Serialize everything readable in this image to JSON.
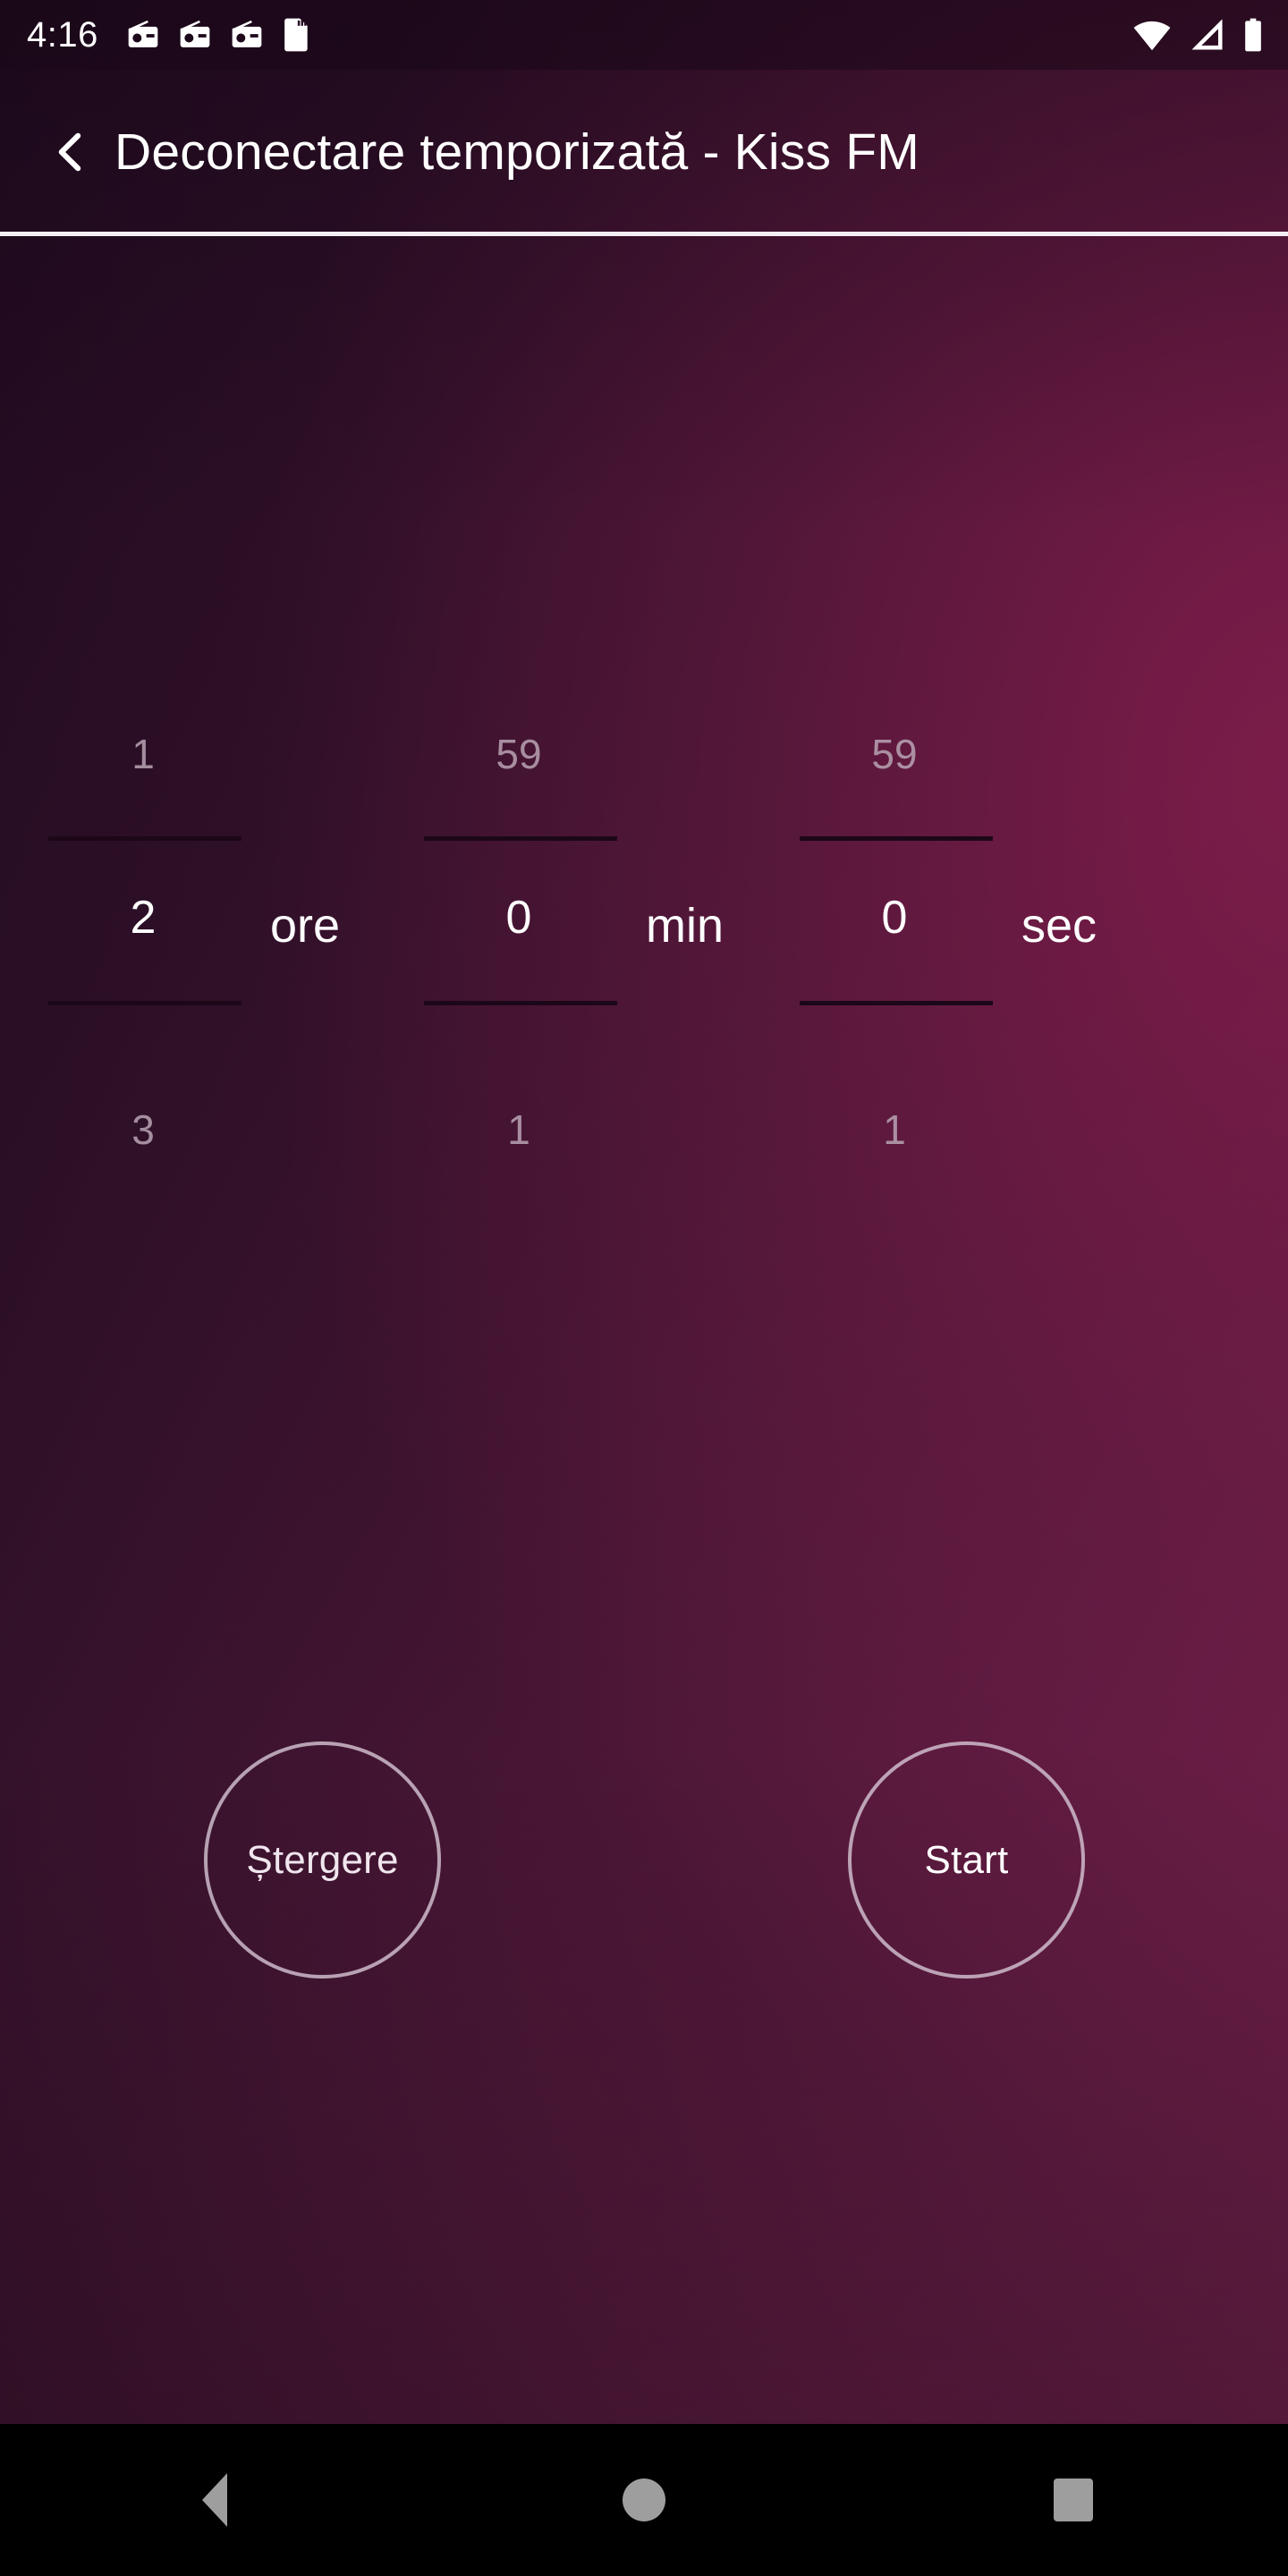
{
  "status_bar": {
    "clock": "4:16",
    "left_icons": [
      "radio-icon",
      "radio-icon",
      "radio-icon",
      "sd-card-icon"
    ],
    "right_icons": [
      "wifi-icon",
      "cellular-signal-icon",
      "battery-icon"
    ]
  },
  "app_bar": {
    "back_icon": "chevron-left-icon",
    "title": "Deconectare temporizată - Kiss FM"
  },
  "timer_picker": {
    "hours": {
      "previous": "1",
      "value": "2",
      "next": "3",
      "unit": "ore"
    },
    "minutes": {
      "previous": "59",
      "value": "0",
      "next": "1",
      "unit": "min"
    },
    "seconds": {
      "previous": "59",
      "value": "0",
      "next": "1",
      "unit": "sec"
    }
  },
  "actions": {
    "clear_label": "Ștergere",
    "start_label": "Start"
  },
  "nav_bar": {
    "back": "back-triangle-icon",
    "home": "home-circle-icon",
    "recents": "recents-square-icon"
  },
  "colors": {
    "accent": "#7c2450",
    "background_dark": "#200a1f",
    "background_light": "#7e1c4a",
    "divider": "#f4eef4",
    "picker_rule": "#1c0718",
    "ghost_text": "#b9a4b4",
    "primary_text": "#ffffff",
    "nav_icon": "#9e9e9e"
  }
}
